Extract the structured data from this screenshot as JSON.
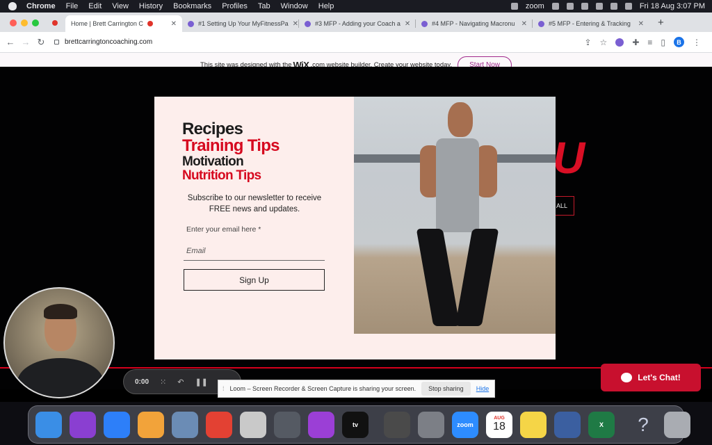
{
  "menubar": {
    "app": "Chrome",
    "items": [
      "File",
      "Edit",
      "View",
      "History",
      "Bookmarks",
      "Profiles",
      "Tab",
      "Window",
      "Help"
    ],
    "zoom_label": "zoom",
    "clock": "Fri 18 Aug  3:07 PM"
  },
  "tabs": [
    {
      "title": "Home | Brett Carrington C",
      "active": true
    },
    {
      "title": "#1 Setting Up Your MyFitnessPa",
      "active": false
    },
    {
      "title": "#3 MFP - Adding your Coach a",
      "active": false
    },
    {
      "title": "#4 MFP - Navigating Macronu",
      "active": false
    },
    {
      "title": "#5 MFP - Entering & Tracking",
      "active": false
    }
  ],
  "toolbar": {
    "url": "brettcarringtoncoaching.com",
    "profile_initial": "B"
  },
  "wix_banner": {
    "text_before": "This site was designed with the",
    "wix": "WiX",
    "text_after": ".com website builder. Create your website today.",
    "button": "Start Now"
  },
  "background": {
    "heading_fragment": "U",
    "button_fragment": "ALL"
  },
  "popup": {
    "headings": [
      "Recipes",
      "Training Tips",
      "Motivation",
      "Nutrition Tips"
    ],
    "subscribe_text": "Subscribe to our newsletter to receive FREE news and updates.",
    "email_label": "Enter your email here *",
    "email_placeholder": "Email",
    "email_value": "",
    "signup_button": "Sign Up"
  },
  "loom": {
    "timer": "0:00",
    "share_message": "Loom – Screen Recorder & Screen Capture is sharing your screen.",
    "stop_sharing": "Stop sharing",
    "hide": "Hide"
  },
  "chat": {
    "label": "Let's Chat!"
  },
  "dock": {
    "apps": [
      {
        "name": "finder",
        "color": "#3a8ee6",
        "label": ""
      },
      {
        "name": "siri",
        "color": "#8a3fd1",
        "label": ""
      },
      {
        "name": "safari",
        "color": "#2d7ff9",
        "label": ""
      },
      {
        "name": "photos",
        "color": "#f2a33a",
        "label": ""
      },
      {
        "name": "preview",
        "color": "#6b8cb5",
        "label": ""
      },
      {
        "name": "chrome",
        "color": "#e34133",
        "label": ""
      },
      {
        "name": "disabled-app",
        "color": "#c9c9c9",
        "label": ""
      },
      {
        "name": "image-capture",
        "color": "#555a63",
        "label": ""
      },
      {
        "name": "podcasts",
        "color": "#9b3fd6",
        "label": ""
      },
      {
        "name": "apple-tv",
        "color": "#111111",
        "label": "tv"
      },
      {
        "name": "calculator",
        "color": "#4a4a4a",
        "label": ""
      },
      {
        "name": "system-preferences",
        "color": "#7c7f86",
        "label": ""
      },
      {
        "name": "zoom",
        "color": "#2d8cff",
        "label": "zoom"
      },
      {
        "name": "calendar",
        "color": "#ffffff",
        "label": "18"
      },
      {
        "name": "notes",
        "color": "#f5d547",
        "label": ""
      },
      {
        "name": "quicktime",
        "color": "#3b5fa0",
        "label": ""
      },
      {
        "name": "excel",
        "color": "#1f7a45",
        "label": "X"
      },
      {
        "name": "help",
        "color": "#7d8fb0",
        "label": "?"
      },
      {
        "name": "trash",
        "color": "#a9acb2",
        "label": ""
      }
    ],
    "calendar_month": "AUG"
  }
}
